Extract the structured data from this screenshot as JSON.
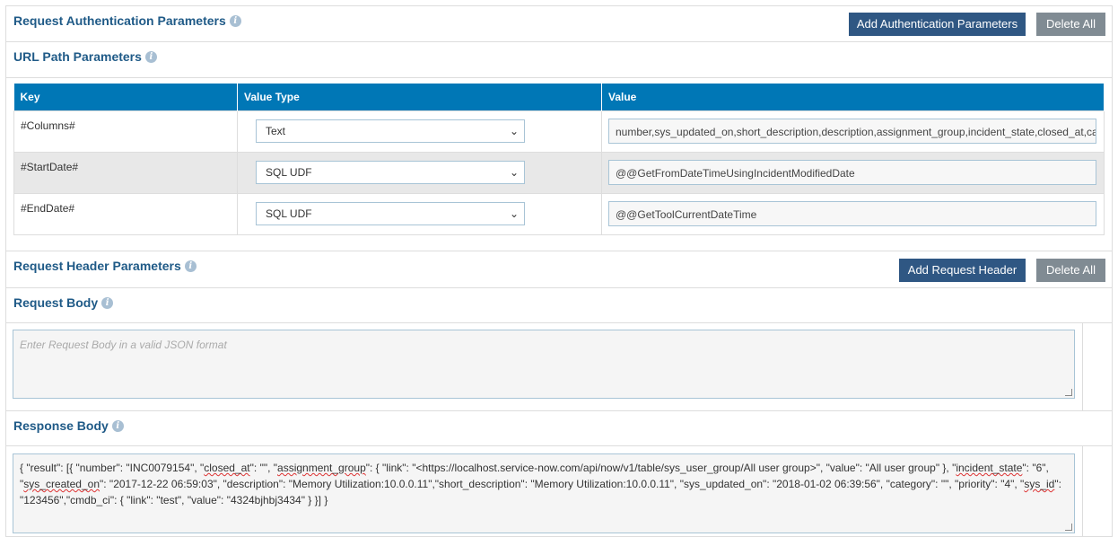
{
  "auth": {
    "title": "Request Authentication Parameters",
    "add_label": "Add Authentication Parameters",
    "delete_label": "Delete All"
  },
  "url_path": {
    "title": "URL Path Parameters",
    "columns": [
      "Key",
      "Value Type",
      "Value"
    ],
    "rows": [
      {
        "key": "#Columns#",
        "type": "Text",
        "value": "number,sys_updated_on,short_description,description,assignment_group,incident_state,closed_at,category"
      },
      {
        "key": "#StartDate#",
        "type": "SQL UDF",
        "value": "@@GetFromDateTimeUsingIncidentModifiedDate"
      },
      {
        "key": "#EndDate#",
        "type": "SQL UDF",
        "value": "@@GetToolCurrentDateTime"
      }
    ]
  },
  "header": {
    "title": "Request Header Parameters",
    "add_label": "Add Request Header",
    "delete_label": "Delete All"
  },
  "request_body": {
    "title": "Request Body",
    "placeholder": "Enter Request Body in a valid JSON format"
  },
  "response_body": {
    "title": "Response Body",
    "parts": [
      "{  \"result\": [{   \"number\": \"INC0079154\",   \"",
      "closed_at",
      "\": \"\",   \"",
      "assignment_group",
      "\": {    \"link\": \"<https://localhost.service-now.com/api/now/v1/table/sys_user_group/All user group>\",    \"value\": \"All user group\"   },   \"",
      "incident_state",
      "\": \"6\",   \"",
      "sys_created_on",
      "\": \"2017-12-22 06:59:03\",   \"description\": \"Memory Utilization:10.0.0.11\",\"short_description\": \"Memory Utilization:10.0.0.11\",   \"sys_updated_on\": \"2018-01-02 06:39:56\",   \"category\": \"\",   \"priority\": \"4\",   \"",
      "sys_id",
      "\": \"123456\",\"cmdb_ci\": {    \"link\": \"test\",    \"value\": \"4324bjhbj3434\"   }  }] }"
    ]
  }
}
